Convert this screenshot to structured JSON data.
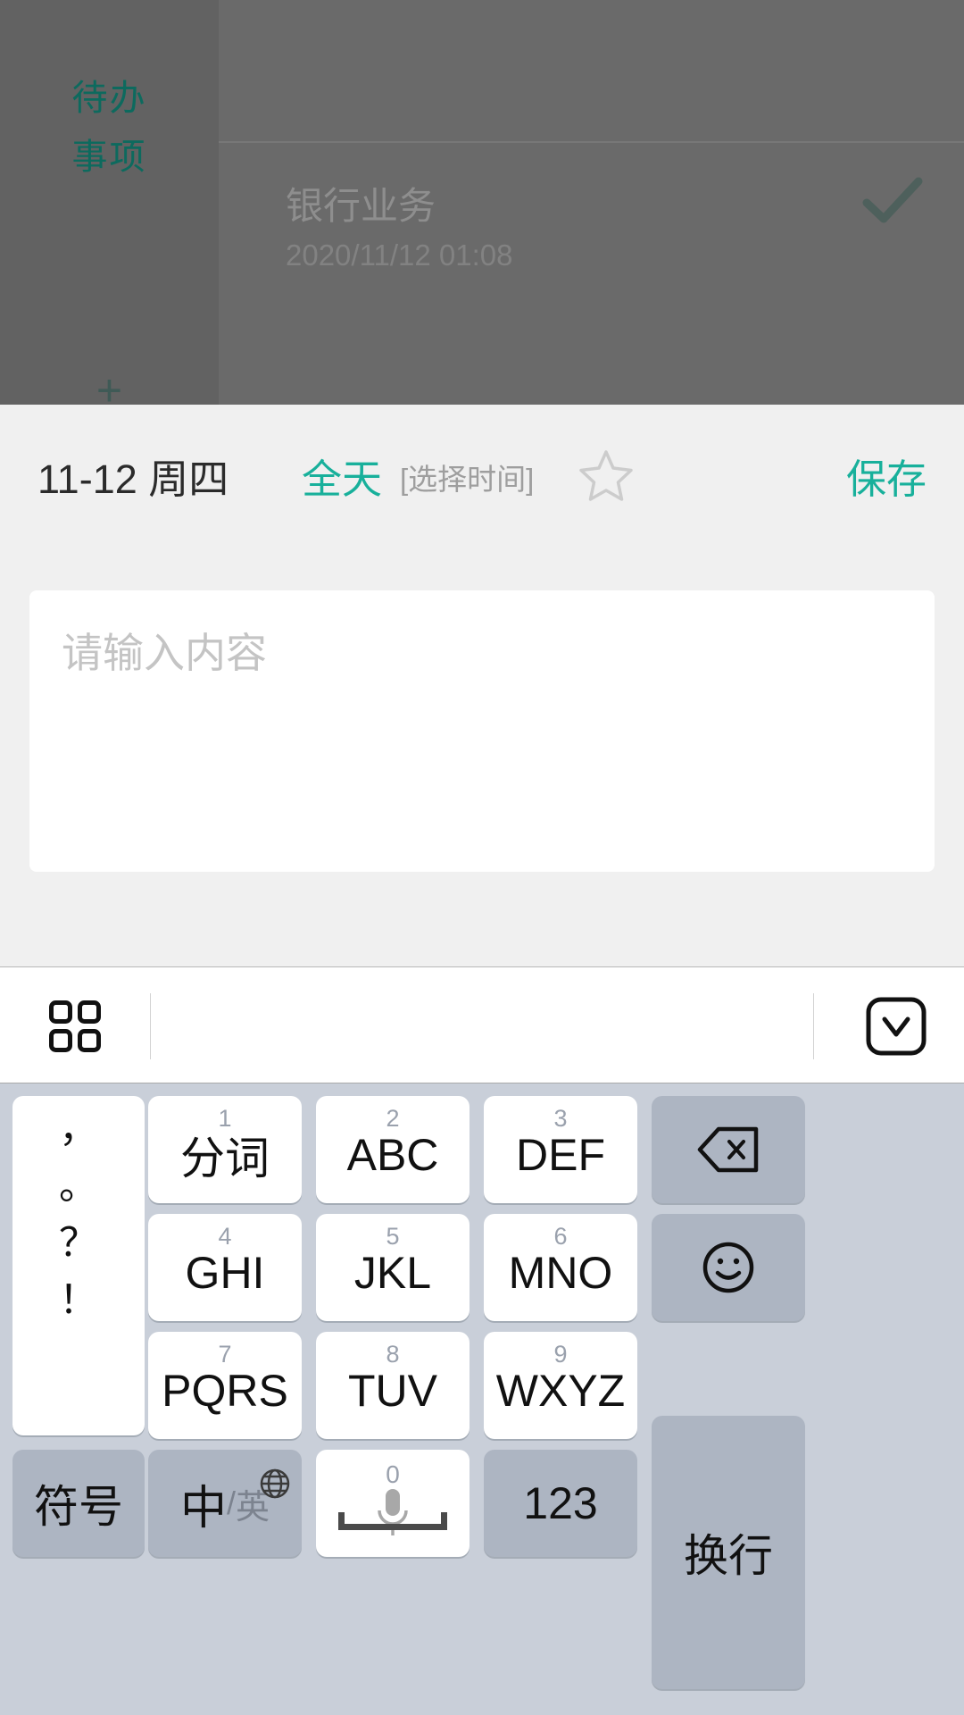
{
  "background_app": {
    "sidebar": {
      "items": [
        {
          "label": "待办"
        },
        {
          "label": "事项"
        }
      ],
      "add_button_label": "+"
    },
    "card": {
      "title": "银行业务",
      "datetime": "2020/11/12 01:08",
      "done_icon": "check-icon"
    },
    "accent_color": "#0d6a5e"
  },
  "editor": {
    "toolbar": {
      "date_label": "11-12 周四",
      "all_day_label": "全天",
      "pick_time_label": "[选择时间]",
      "star_icon": "star-outline-icon",
      "save_label": "保存",
      "accent_color": "#18b09b"
    },
    "note": {
      "value": "",
      "placeholder": "请输入内容"
    }
  },
  "keyboard": {
    "function_bar": {
      "grid_icon": "grid-2x2-icon",
      "hide_icon": "chevron-down-boxed-icon"
    },
    "punctuation_key": {
      "name": "punctuation-key",
      "symbols": [
        "，",
        "。",
        "？",
        "！"
      ]
    },
    "keys": [
      {
        "sub": "1",
        "main": "分词",
        "name": "key-1-fenci",
        "style": "white"
      },
      {
        "sub": "2",
        "main": "ABC",
        "name": "key-2-abc",
        "style": "white"
      },
      {
        "sub": "3",
        "main": "DEF",
        "name": "key-3-def",
        "style": "white"
      },
      {
        "sub": "4",
        "main": "GHI",
        "name": "key-4-ghi",
        "style": "white"
      },
      {
        "sub": "5",
        "main": "JKL",
        "name": "key-5-jkl",
        "style": "white"
      },
      {
        "sub": "6",
        "main": "MNO",
        "name": "key-6-mno",
        "style": "white"
      },
      {
        "sub": "7",
        "main": "PQRS",
        "name": "key-7-pqrs",
        "style": "white"
      },
      {
        "sub": "8",
        "main": "TUV",
        "name": "key-8-tuv",
        "style": "white"
      },
      {
        "sub": "9",
        "main": "WXYZ",
        "name": "key-9-wxyz",
        "style": "white"
      }
    ],
    "backspace_key": {
      "icon": "backspace-icon"
    },
    "emoji_key": {
      "icon": "smiley-icon"
    },
    "enter_key": {
      "label": "换行"
    },
    "symbol_key": {
      "label": "符号"
    },
    "lang_key": {
      "primary": "中",
      "separator": "/",
      "secondary": "英",
      "icon": "globe-icon"
    },
    "space_key": {
      "sub": "0",
      "icon": "microphone-icon"
    },
    "numeric_key": {
      "label": "123"
    }
  }
}
